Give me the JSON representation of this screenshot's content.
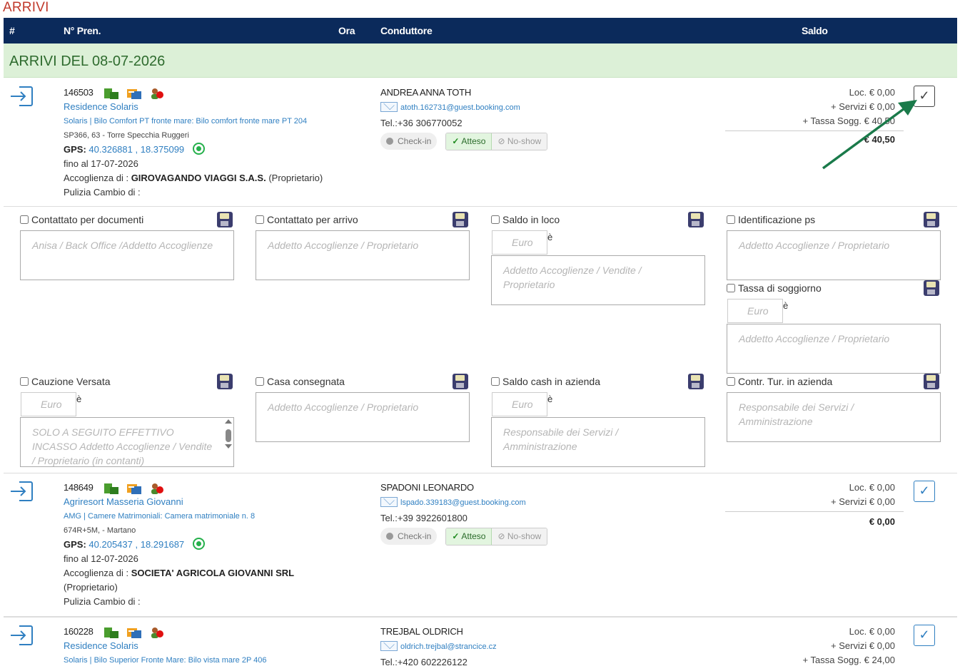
{
  "page_title": "ARRIVI",
  "header": {
    "col_num": "#",
    "col_pren": "N° Pren.",
    "col_ora": "Ora",
    "col_conduttore": "Conduttore",
    "col_saldo": "Saldo"
  },
  "date_band": {
    "label": "ARRIVI DEL 08-07-2026"
  },
  "status_buttons": {
    "checkin": "Check-in",
    "atteso": "Atteso",
    "noshow": "No-show"
  },
  "bookings": [
    {
      "number": "146503",
      "residence": "Residence Solaris",
      "unit": "Solaris | Bilo Comfort PT fronte mare: Bilo comfort fronte mare PT 204",
      "address": "SP366, 63 - Torre Specchia Ruggeri",
      "gps_label": "GPS:",
      "gps_value": "40.326881 , 18.375099",
      "until": "fino al 17-07-2026",
      "acc_label": "Accoglienza di :",
      "acc_name": "GIROVAGANDO VIAGGI S.A.S.",
      "acc_role": "(Proprietario)",
      "pulizia": "Pulizia Cambio di :",
      "driver": "ANDREA ANNA TOTH",
      "email": "atoth.162731@guest.booking.com",
      "tel": "Tel.:+36 306770052",
      "loc": "Loc. € 0,00",
      "servizi": "+ Servizi € 0,00",
      "tassa": "+ Tassa Sogg. € 40,50",
      "total": "€ 40,50"
    },
    {
      "number": "148649",
      "residence": "Agriresort Masseria Giovanni",
      "unit": "AMG | Camere Matrimoniali: Camera matrimoniale n. 8",
      "address": "674R+5M, - Martano",
      "gps_label": "GPS:",
      "gps_value": "40.205437 , 18.291687",
      "until": "fino al 12-07-2026",
      "acc_label": "Accoglienza di :",
      "acc_name": "SOCIETA' AGRICOLA GIOVANNI SRL",
      "acc_role": "(Proprietario)",
      "pulizia": "Pulizia Cambio di :",
      "driver": "SPADONI LEONARDO",
      "email": "lspado.339183@guest.booking.com",
      "tel": "Tel.:+39 3922601800",
      "loc": "Loc. € 0,00",
      "servizi": "+ Servizi € 0,00",
      "total": "€ 0,00"
    },
    {
      "number": "160228",
      "residence": "Residence Solaris",
      "unit": "Solaris | Bilo Superior Fronte Mare: Bilo vista mare 2P 406",
      "driver": "TREJBAL OLDRICH",
      "email": "oldrich.trejbal@strancice.cz",
      "tel": "Tel.:+420 602226122",
      "loc": "Loc. € 0,00",
      "servizi": "+ Servizi € 0,00",
      "tassa": "+ Tassa Sogg. € 24,00"
    }
  ],
  "form": {
    "contattato_doc": {
      "label": "Contattato per documenti",
      "placeholder": "Anisa / Back Office /Addetto Accoglienze"
    },
    "contattato_arrivo": {
      "label": "Contattato per arrivo",
      "placeholder": "Addetto Accoglienze / Proprietario"
    },
    "saldo_loco": {
      "label": "Saldo in loco",
      "euro": "Euro",
      "e": "è",
      "placeholder": "Addetto Accoglienze / Vendite / Proprietario"
    },
    "identificazione": {
      "label": "Identificazione ps",
      "placeholder": "Addetto Accoglienze / Proprietario"
    },
    "tassa_soggiorno": {
      "label": "Tassa di soggiorno",
      "euro": "Euro",
      "e": "è",
      "placeholder": "Addetto Accoglienze / Proprietario"
    },
    "cauzione": {
      "label": "Cauzione Versata",
      "euro": "Euro",
      "e": "è",
      "placeholder": "SOLO A SEGUITO EFFETTIVO INCASSO Addetto Accoglienze / Vendite / Proprietario (in contanti)"
    },
    "casa": {
      "label": "Casa consegnata",
      "placeholder": "Addetto Accoglienze / Proprietario"
    },
    "saldo_cash": {
      "label": "Saldo cash in azienda",
      "euro": "Euro",
      "e": "è",
      "placeholder": "Responsabile dei Servizi  / Amministrazione"
    },
    "contr_tur": {
      "label": "Contr. Tur. in azienda",
      "placeholder": "Responsabile dei Servizi  / Amministrazione"
    }
  },
  "colors": {
    "header_bg": "#0b2a5b",
    "date_band_bg": "#dcf0d7",
    "link": "#2f7fc1",
    "title": "#c0392b",
    "annotation_arrow": "#1a7a4a"
  }
}
